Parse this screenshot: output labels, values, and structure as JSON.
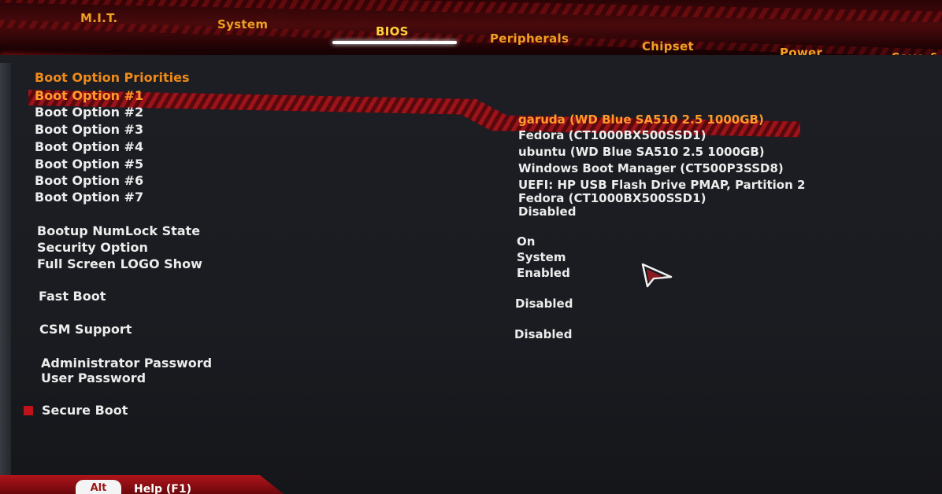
{
  "tabs": [
    {
      "label": "M.I.T.",
      "active": false
    },
    {
      "label": "System",
      "active": false
    },
    {
      "label": "BIOS",
      "active": true
    },
    {
      "label": "Peripherals",
      "active": false
    },
    {
      "label": "Chipset",
      "active": false
    },
    {
      "label": "Power",
      "active": false
    },
    {
      "label": "Save &",
      "active": false
    }
  ],
  "section_title": "Boot Option Priorities",
  "boot_options": [
    {
      "label": "Boot Option #1",
      "value": "garuda (WD Blue SA510 2.5 1000GB)",
      "selected": true
    },
    {
      "label": "Boot Option #2",
      "value": "Fedora (CT1000BX500SSD1)"
    },
    {
      "label": "Boot Option #3",
      "value": "ubuntu (WD Blue SA510 2.5 1000GB)"
    },
    {
      "label": "Boot Option #4",
      "value": "Windows Boot Manager (CT500P3SSD8)"
    },
    {
      "label": "Boot Option #5",
      "value": "UEFI: HP USB Flash Drive PMAP, Partition 2"
    },
    {
      "label": "Boot Option #6",
      "value": "Fedora (CT1000BX500SSD1)"
    },
    {
      "label": "Boot Option #7",
      "value": "Disabled"
    }
  ],
  "settings": {
    "numlock": {
      "label": "Bootup NumLock State",
      "value": "On"
    },
    "security": {
      "label": "Security Option",
      "value": "System"
    },
    "logo": {
      "label": "Full Screen LOGO Show",
      "value": "Enabled"
    },
    "fastboot": {
      "label": "Fast Boot",
      "value": "Disabled"
    },
    "csm": {
      "label": "CSM Support",
      "value": "Disabled"
    },
    "admin_pw": {
      "label": "Administrator Password"
    },
    "user_pw": {
      "label": "User Password"
    },
    "secure_boot": {
      "label": "Secure Boot"
    }
  },
  "bottom": {
    "alt_key": "Alt",
    "help_key": "Help (F1)"
  },
  "colors": {
    "accent_orange": "#f08a18",
    "selected_orange": "#ff9a2a",
    "active_tab_yellow": "#ffd23a",
    "brand_red": "#c01218",
    "panel_bg": "#1c1e24"
  },
  "icons": {
    "cursor": "arrow-cursor-icon",
    "secure_boot_bullet": "square-bullet-icon"
  }
}
